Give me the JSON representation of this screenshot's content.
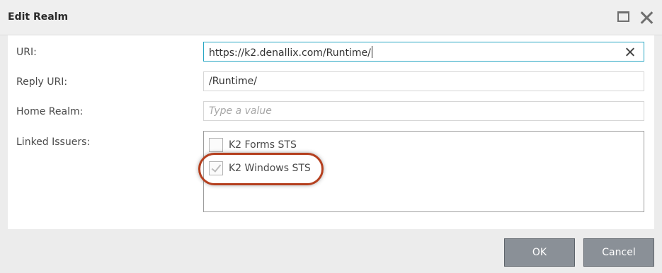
{
  "dialog": {
    "title": "Edit Realm",
    "maximize_icon": "maximize-icon",
    "close_icon": "close-icon"
  },
  "form": {
    "uri": {
      "label": "URI:",
      "value": "https://k2.denallix.com/Runtime/"
    },
    "reply_uri": {
      "label": "Reply URI:",
      "value": "/Runtime/"
    },
    "home_realm": {
      "label": "Home Realm:",
      "value": "",
      "placeholder": "Type a value"
    },
    "linked_issuers": {
      "label": "Linked Issuers:",
      "items": [
        {
          "label": "K2 Forms STS",
          "checked": false
        },
        {
          "label": "K2 Windows STS",
          "checked": true,
          "disabled": true
        }
      ]
    }
  },
  "buttons": {
    "ok": "OK",
    "cancel": "Cancel"
  },
  "colors": {
    "highlight": "#b5401f",
    "focus": "#2aa7c4",
    "button": "#8a9097"
  }
}
